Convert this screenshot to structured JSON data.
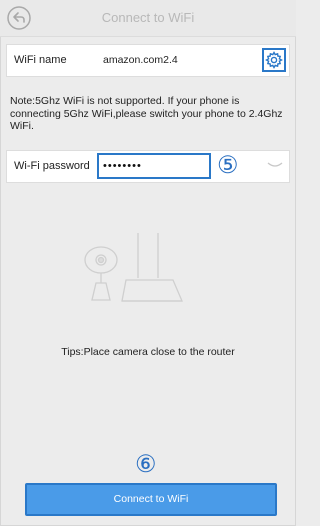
{
  "header": {
    "title": "Connect to WiFi",
    "back_icon": "back-arrow-icon"
  },
  "wifi": {
    "label": "WiFi name",
    "value": "amazon.com2.4",
    "settings_icon": "gear-icon"
  },
  "note": "Note:5Ghz WiFi is not supported. If your phone is connecting 5Ghz WiFi,please switch your phone to 2.4Ghz WiFi.",
  "password": {
    "label": "Wi-Fi password",
    "value": "••••••••",
    "step_marker": "⑤",
    "toggle_icon": "chevron-down-icon"
  },
  "tips": "Tips:Place camera close to the router",
  "footer": {
    "step_marker": "⑥",
    "button_label": "Connect to WiFi"
  },
  "colors": {
    "accent": "#2a78c8",
    "button_fill": "#4a9be8",
    "background": "#ececec"
  }
}
